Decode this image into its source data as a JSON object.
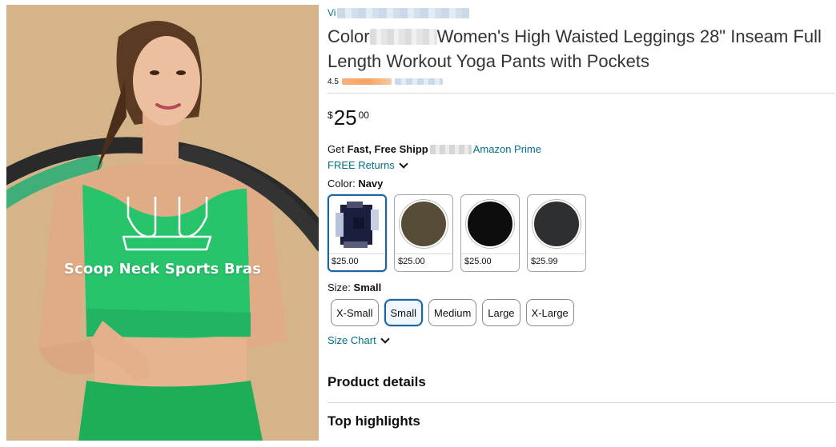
{
  "product_image": {
    "overlay_label": "Scoop Neck Sports Bras",
    "icon": "sports-bra-outline-icon",
    "background_color": "#d9b98e",
    "garment_color": "#2ecc71"
  },
  "brand": {
    "label": "Vi"
  },
  "title": {
    "prefix": "Color",
    "text": "Women's High Waisted Leggings 28\" Inseam Full Length Workout Yoga Pants with Pockets"
  },
  "rating": {
    "value": "4.5"
  },
  "price": {
    "symbol": "$",
    "whole": "25",
    "fraction": "00"
  },
  "shipping": {
    "get": "Get",
    "fast_free": "Fast, Free Shipp",
    "prime": "Amazon Prime"
  },
  "returns": {
    "label": "FREE Returns",
    "icon": "chevron-down-icon"
  },
  "color": {
    "label": "Color:",
    "selected": "Navy",
    "options": [
      {
        "price": "$25.00",
        "swatch": "#1b1f3f"
      },
      {
        "price": "$25.00",
        "swatch": "#574d37"
      },
      {
        "price": "$25.00",
        "swatch": "#0d0d0d"
      },
      {
        "price": "$25.99",
        "swatch": "#2e2f33"
      }
    ]
  },
  "size": {
    "label": "Size:",
    "selected": "Small",
    "options": [
      "X-Small",
      "Small",
      "Medium",
      "Large",
      "X-Large"
    ]
  },
  "size_chart": {
    "label": "Size Chart",
    "icon": "chevron-down-icon"
  },
  "sections": {
    "product_details": "Product details",
    "top_highlights": "Top highlights"
  },
  "colors": {
    "link": "#007185",
    "selected_border": "#2162a1",
    "divider": "#d5d9d9"
  }
}
